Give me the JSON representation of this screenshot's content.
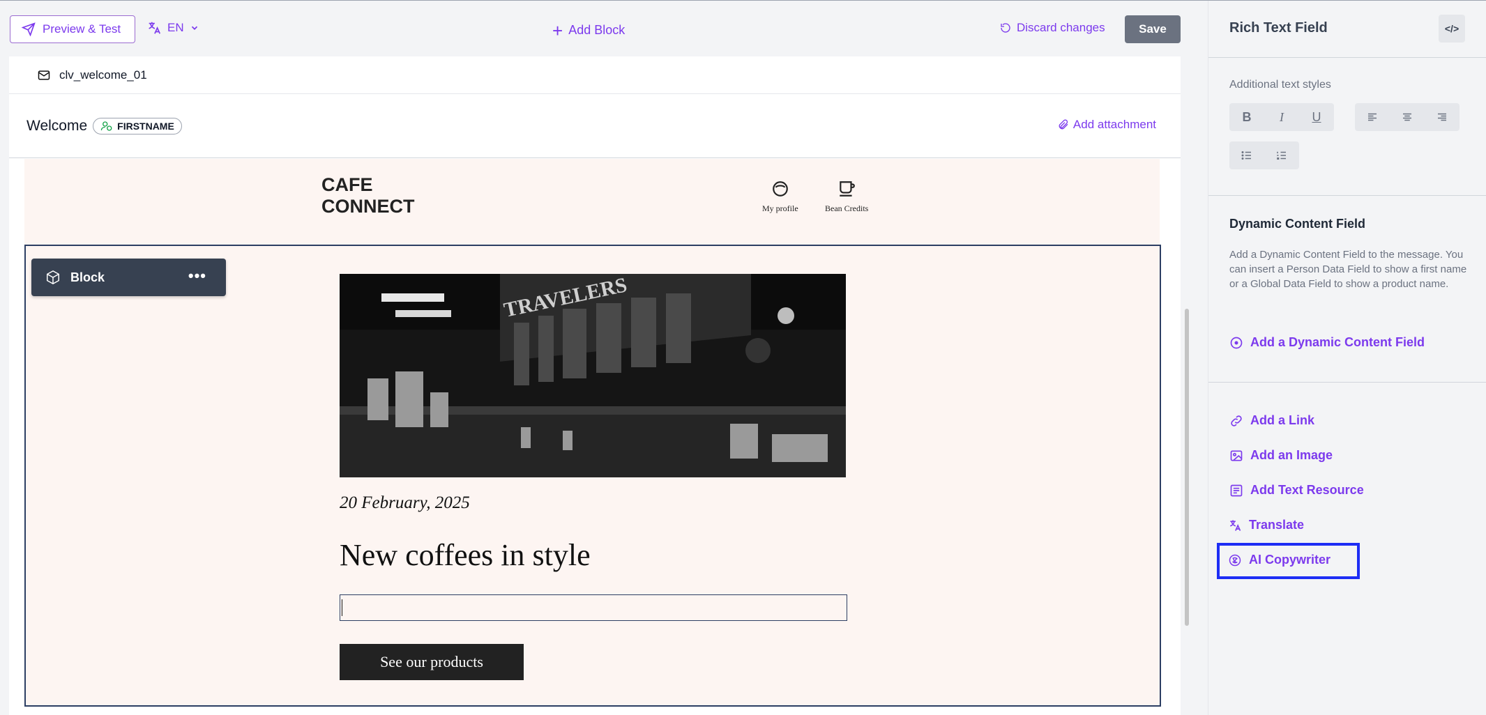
{
  "toolbar": {
    "preview_label": "Preview & Test",
    "language": "EN",
    "add_block_label": "Add Block",
    "discard_label": "Discard changes",
    "save_label": "Save"
  },
  "template": {
    "name": "clv_welcome_01"
  },
  "subject": {
    "text": "Welcome",
    "chip_label": "FIRSTNAME",
    "add_attachment_label": "Add attachment"
  },
  "email": {
    "brand_line1": "CAFE",
    "brand_line2": "CONNECT",
    "nav": [
      {
        "label": "My profile",
        "icon": "profile-icon"
      },
      {
        "label": "Bean Credits",
        "icon": "coffee-cup-icon"
      }
    ],
    "block_label": "Block",
    "date": "20 February, 2025",
    "headline": "New coffees in style",
    "cta_label": "See our products",
    "hero_alt": "TRAVELERS"
  },
  "panel": {
    "title": "Rich Text Field",
    "code_label": "</>",
    "styles_label": "Additional text styles",
    "dynamic_title": "Dynamic Content Field",
    "dynamic_desc": "Add a Dynamic Content Field to the message. You can insert a Person Data Field to show a first name or a Global Data Field to show a product name.",
    "add_dynamic_label": "Add a Dynamic Content Field",
    "actions": [
      {
        "label": "Add a Link",
        "icon": "link-icon"
      },
      {
        "label": "Add an Image",
        "icon": "image-icon"
      },
      {
        "label": "Add Text Resource",
        "icon": "text-resource-icon"
      },
      {
        "label": "Translate",
        "icon": "translate-icon"
      },
      {
        "label": "AI Copywriter",
        "icon": "ai-icon"
      }
    ]
  },
  "colors": {
    "accent": "#7c3aed",
    "dark": "#374151",
    "email_bg": "#fdf5f2",
    "highlight": "#1d2df5"
  }
}
